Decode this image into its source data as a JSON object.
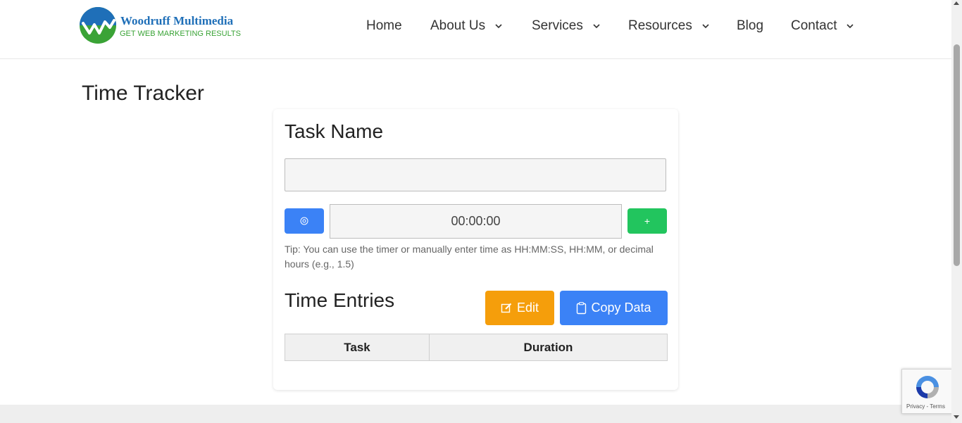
{
  "brand": {
    "name": "Woodruff Multimedia",
    "tagline": "GET WEB MARKETING RESULTS",
    "colors": {
      "blue": "#1f6fb8",
      "green": "#3aa336"
    }
  },
  "nav": {
    "items": [
      {
        "label": "Home",
        "has_dropdown": false
      },
      {
        "label": "About Us",
        "has_dropdown": true
      },
      {
        "label": "Services",
        "has_dropdown": true
      },
      {
        "label": "Resources",
        "has_dropdown": true
      },
      {
        "label": "Blog",
        "has_dropdown": false
      },
      {
        "label": "Contact",
        "has_dropdown": true
      }
    ]
  },
  "page": {
    "title": "Time Tracker"
  },
  "tracker": {
    "task_label": "Task Name",
    "task_value": "",
    "timer_icon": "target-icon",
    "time_value": "00:00:00",
    "add_label": "+",
    "tip": "Tip: You can use the timer or manually enter time as HH:MM:SS, HH:MM, or decimal hours (e.g., 1.5)",
    "entries_title": "Time Entries",
    "edit_label": "Edit",
    "copy_label": "Copy Data",
    "table": {
      "columns": [
        "Task",
        "Duration"
      ],
      "rows": []
    },
    "colors": {
      "timer": "#3b82f6",
      "add": "#22c55e",
      "edit": "#f59e0b",
      "copy": "#3b82f6"
    }
  },
  "recaptcha": {
    "links": "Privacy - Terms"
  }
}
